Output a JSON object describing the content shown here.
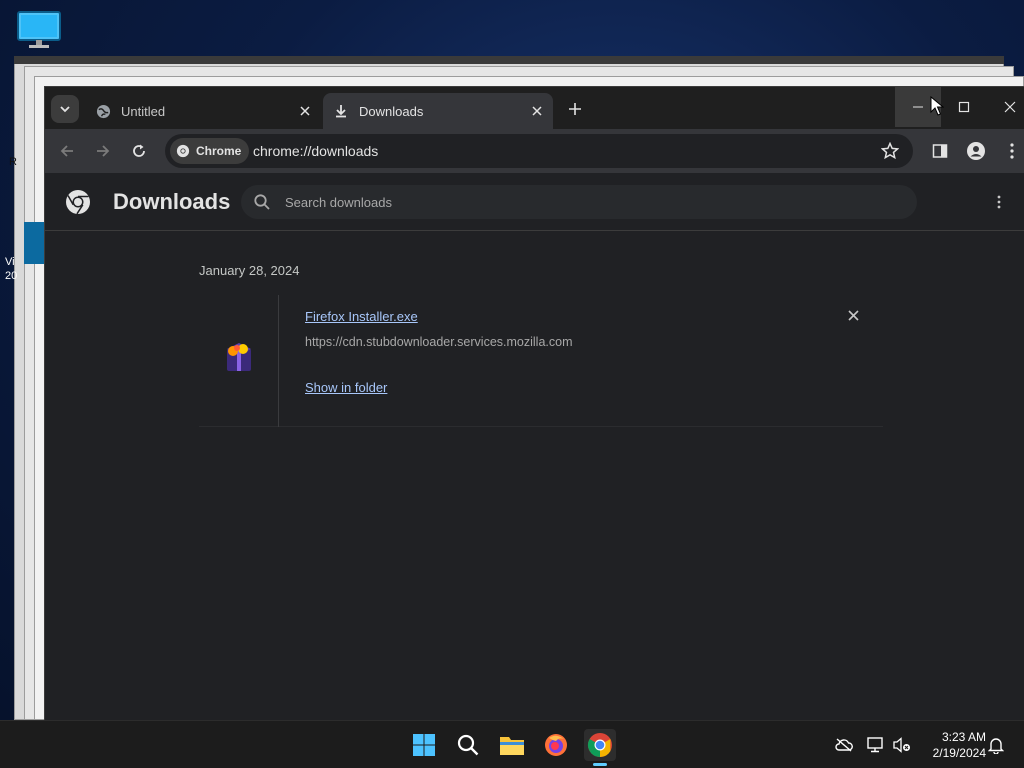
{
  "desktop": {
    "edge_text_1": "R",
    "edge_text_2": "Vi",
    "edge_text_3": "20"
  },
  "browser": {
    "tabs": [
      {
        "label": "Untitled",
        "icon": "globe-icon",
        "active": false
      },
      {
        "label": "Downloads",
        "icon": "download-icon",
        "active": true
      }
    ],
    "omnibox": {
      "chip_label": "Chrome",
      "url": "chrome://downloads"
    }
  },
  "downloads": {
    "title": "Downloads",
    "search_placeholder": "Search downloads",
    "date": "January 28, 2024",
    "items": [
      {
        "file_name": "Firefox Installer.exe",
        "source_url": "https://cdn.stubdownloader.services.mozilla.com",
        "action": "Show in folder"
      }
    ]
  },
  "taskbar": {
    "time": "3:23 AM",
    "date": "2/19/2024",
    "apps": [
      "windows-start-icon",
      "search-icon",
      "file-explorer-icon",
      "firefox-icon",
      "chrome-icon"
    ]
  },
  "colors": {
    "link": "#a8c7fa",
    "page_bg": "#202124",
    "toolbar_bg": "#35363a",
    "accent": "#60cdff"
  }
}
